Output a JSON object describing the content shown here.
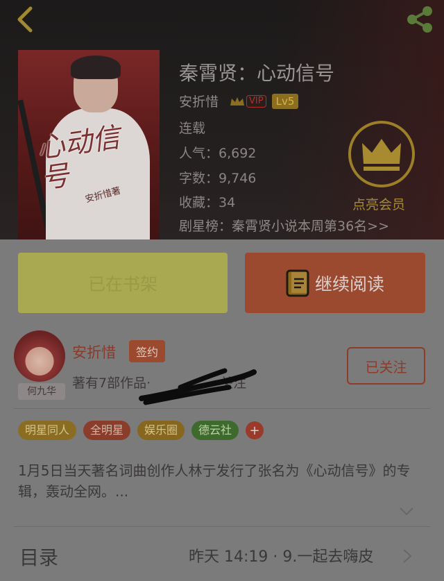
{
  "book": {
    "title": "秦霄贤：心动信号",
    "author": "安折惜",
    "vip_label": "VIP",
    "level": "Lv5",
    "status": "连载",
    "popularity": "人气：6,692",
    "word_count": "字数：9,746",
    "favorites": "收藏：34",
    "rank": "剧星榜：秦霄贤小说本周第36名>>",
    "cover_title": "心动信号",
    "cover_author": "安折惜著"
  },
  "member": {
    "label": "点亮会员"
  },
  "actions": {
    "shelf_label": "已在书架",
    "read_label": "继续阅读"
  },
  "author_profile": {
    "name": "安折惜",
    "sign_badge": "签约",
    "works": "著有7部作品·",
    "works_suffix": "关注",
    "avatar_tag": "何九华",
    "follow_label": "已关注"
  },
  "tags": [
    {
      "label": "明星同人",
      "bg": "#8a6c22",
      "color": "#d5c48a"
    },
    {
      "label": "全明星",
      "bg": "#8a3d2a",
      "color": "#d0b7a8"
    },
    {
      "label": "娱乐圈",
      "bg": "#87661f",
      "color": "#d5c48a"
    },
    {
      "label": "德云社",
      "bg": "#3f6a2e",
      "color": "#bcd3a7"
    }
  ],
  "tag_more": "+",
  "description": "1月5日当天著名词曲创作人林亍发行了张名为《心动信号》的专辑，轰动全网。...",
  "toc": {
    "label": "目录",
    "latest": "昨天 14:19 · 9.一起去嗨皮"
  },
  "colors": {
    "accent": "#9c4a2f",
    "gold": "#a88b30"
  }
}
